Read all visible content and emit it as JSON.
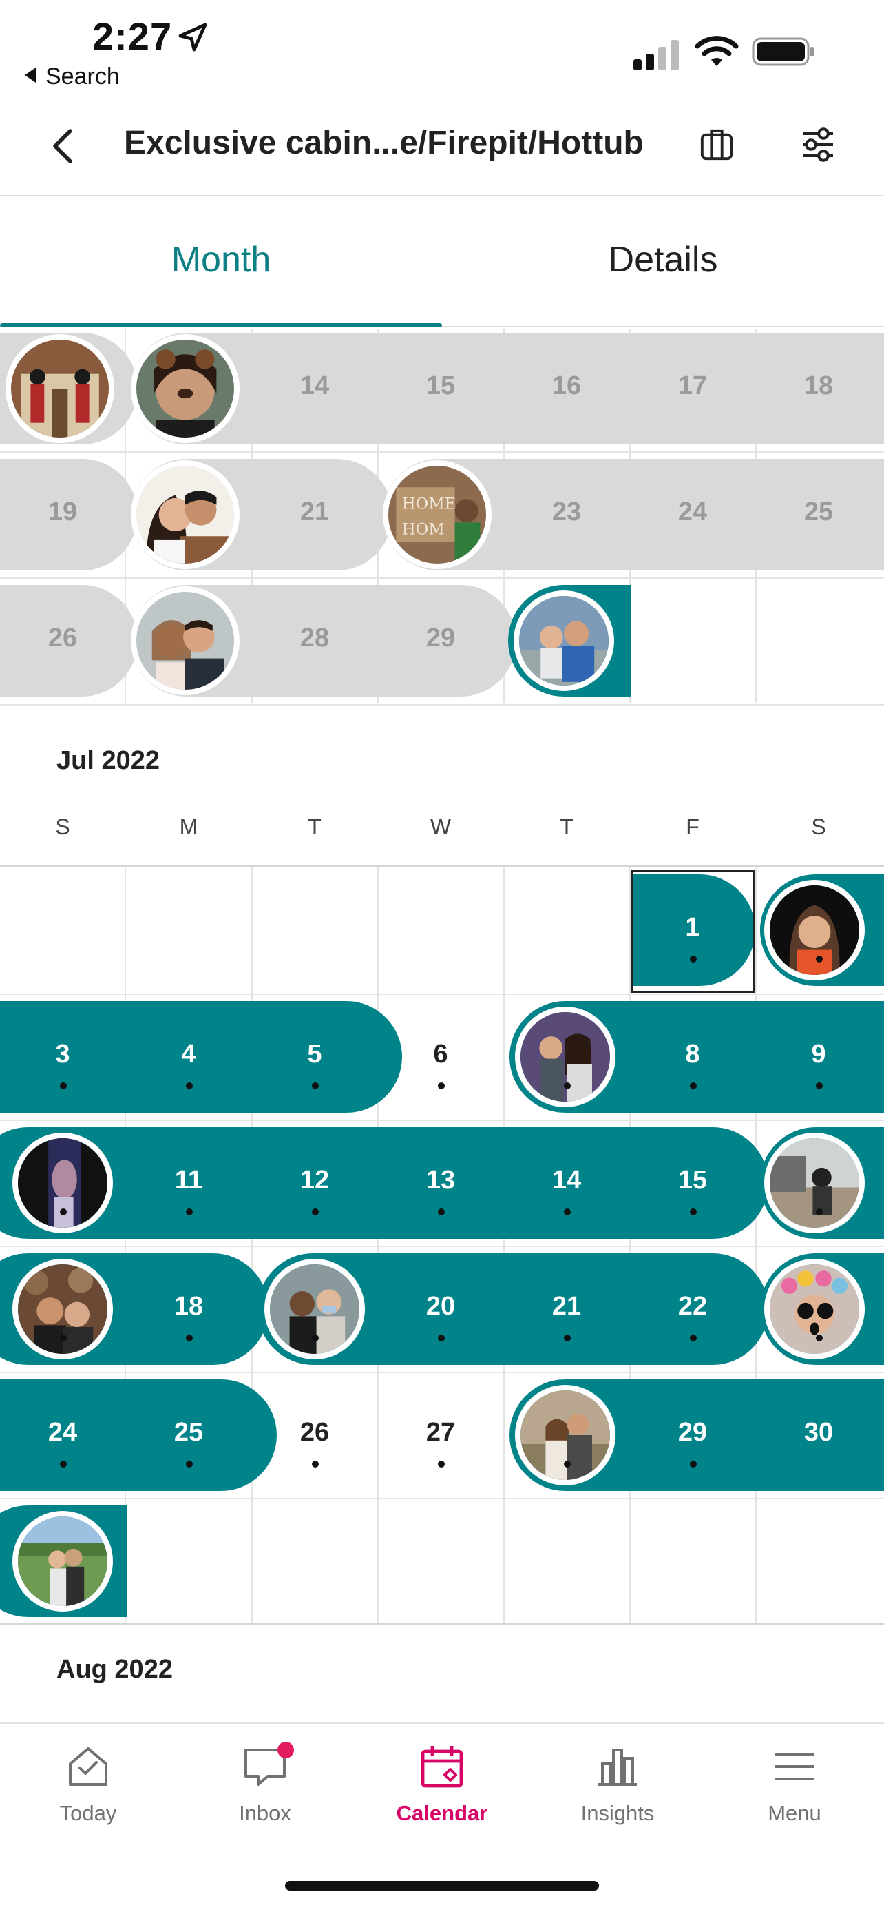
{
  "status_bar": {
    "time": "2:27",
    "back_label": "Search"
  },
  "header": {
    "title": "Exclusive cabin...e/Firepit/Hottub",
    "back_icon": "chevron-left-icon",
    "calendar_icon": "calendar-list-icon",
    "filter_icon": "sliders-icon"
  },
  "tabs": {
    "month": "Month",
    "details": "Details",
    "active": "Month"
  },
  "june_partial": {
    "week1": [
      "14",
      "15",
      "16",
      "17",
      "18"
    ],
    "week2": [
      "19",
      "21",
      "23",
      "24",
      "25"
    ],
    "week3": [
      "26",
      "28",
      "29"
    ]
  },
  "july": {
    "label": "Jul 2022",
    "weekdays": [
      "S",
      "M",
      "T",
      "W",
      "T",
      "F",
      "S"
    ],
    "days": {
      "d1": "1",
      "d3": "3",
      "d4": "4",
      "d5": "5",
      "d6": "6",
      "d8": "8",
      "d9": "9",
      "d11": "11",
      "d12": "12",
      "d13": "13",
      "d14": "14",
      "d15": "15",
      "d18": "18",
      "d20": "20",
      "d21": "21",
      "d22": "22",
      "d24": "24",
      "d25": "25",
      "d26": "26",
      "d27": "27",
      "d29": "29",
      "d30": "30"
    }
  },
  "august": {
    "label": "Aug 2022"
  },
  "tabbar": {
    "items": [
      {
        "label": "Today",
        "icon": "house-check-icon"
      },
      {
        "label": "Inbox",
        "icon": "message-bubble-icon"
      },
      {
        "label": "Calendar",
        "icon": "calendar-icon"
      },
      {
        "label": "Insights",
        "icon": "bar-chart-icon"
      },
      {
        "label": "Menu",
        "icon": "hamburger-icon"
      }
    ],
    "active": "Calendar"
  },
  "colors": {
    "teal": "#008489",
    "past_gray": "#d9d9d9",
    "active_pink": "#d70466",
    "inbox_badge": "#e31c5f"
  }
}
